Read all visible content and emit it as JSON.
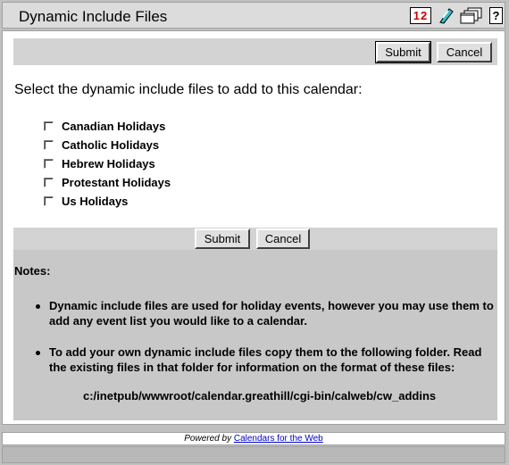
{
  "header": {
    "title": "Dynamic Include Files",
    "icons": [
      "calendar-icon",
      "notes-icon",
      "windows-icon",
      "help-icon"
    ],
    "calendar_icon_text": "12",
    "help_icon_text": "?"
  },
  "form": {
    "submit_label": "Submit",
    "cancel_label": "Cancel",
    "prompt": "Select the dynamic include files to add to this calendar:",
    "options": [
      {
        "label": "Canadian Holidays",
        "checked": false
      },
      {
        "label": "Catholic Holidays",
        "checked": false
      },
      {
        "label": "Hebrew Holidays",
        "checked": false
      },
      {
        "label": "Protestant Holidays",
        "checked": false
      },
      {
        "label": "Us Holidays",
        "checked": false
      }
    ]
  },
  "notes": {
    "heading": "Notes:",
    "items": [
      "Dynamic include files are used for holiday events, however you may use them to add any event list you would like to a calendar.",
      "To add your own dynamic include files copy them to the following folder. Read the existing files in that folder for information on the format of these files:"
    ],
    "path": "c:/inetpub/wwwroot/calendar.greathill/cgi-bin/calweb/cw_addins"
  },
  "footer": {
    "prefix": "Powered by",
    "link": "Calendars for the Web"
  },
  "colors": {
    "background": "#c0c0c0",
    "panel": "#d3d3d3",
    "link": "#0000cc"
  }
}
